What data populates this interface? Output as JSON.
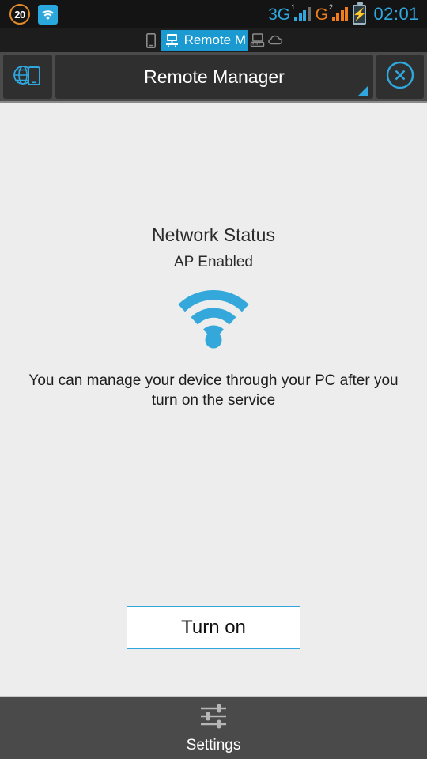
{
  "statusbar": {
    "notification_count": "20",
    "wifi_icon": "wifi-icon",
    "sim1_network": "3G",
    "sim1_index": "1",
    "sim2_network": "G",
    "sim2_index": "2",
    "battery_icon": "battery-charging-icon",
    "clock": "02:01",
    "colors": {
      "sim1": "#2fa8e0",
      "sim2": "#f07d1a",
      "clock": "#2fa8e0",
      "badge_ring": "#e08a28",
      "wifi_badge_bg": "#2aa7dd"
    }
  },
  "tabstrip": {
    "items": [
      {
        "icon": "phone-icon",
        "label": ""
      },
      {
        "icon": "remote-desktop-icon",
        "label": "Remote M",
        "active": true
      },
      {
        "icon": "computer-icon",
        "label": ""
      },
      {
        "icon": "cloud-icon",
        "label": ""
      }
    ],
    "active_bg": "#1a9ad0"
  },
  "titlebar": {
    "left_icon": "globe-phone-icon",
    "title": "Remote Manager",
    "close_icon": "close-circle-icon",
    "expand_indicator": "corner-triangle-icon",
    "accent": "#2fa8e0"
  },
  "main": {
    "network_status_title": "Network Status",
    "network_status_value": "AP Enabled",
    "wifi_icon": "wifi-signal-icon",
    "wifi_color": "#35a8db",
    "description": "You can manage your device through your PC after you turn on the service",
    "turn_on_label": "Turn on",
    "turn_on_border_color": "#31a6dd"
  },
  "bottombar": {
    "settings_icon": "sliders-icon",
    "settings_label": "Settings",
    "background": "#4a4a4a"
  }
}
